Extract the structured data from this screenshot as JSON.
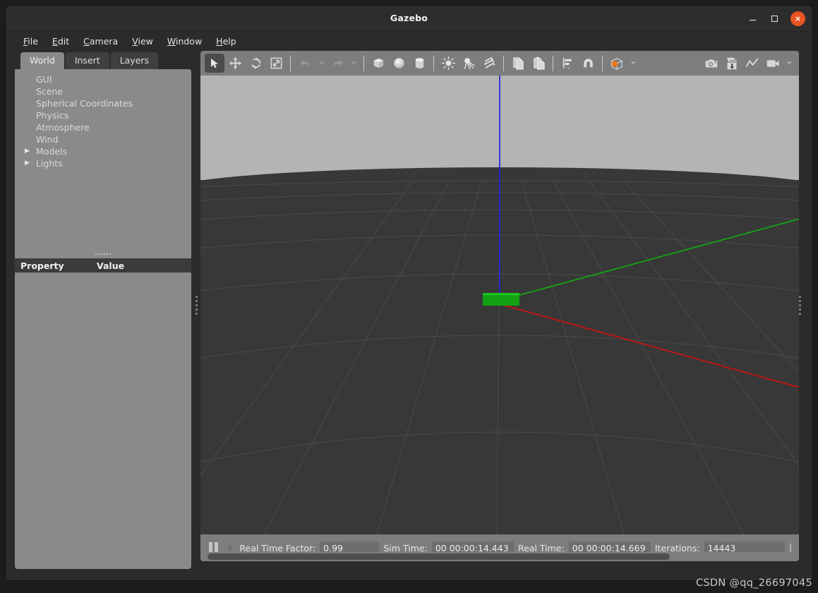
{
  "window": {
    "title": "Gazebo",
    "minimize_label": "minimize",
    "maximize_label": "maximize",
    "close_label": "×"
  },
  "menubar": {
    "items": [
      {
        "label": "File",
        "mnemonic": "F"
      },
      {
        "label": "Edit",
        "mnemonic": "E"
      },
      {
        "label": "Camera",
        "mnemonic": "C"
      },
      {
        "label": "View",
        "mnemonic": "V"
      },
      {
        "label": "Window",
        "mnemonic": "W"
      },
      {
        "label": "Help",
        "mnemonic": "H"
      }
    ]
  },
  "left_panel": {
    "tabs": [
      {
        "label": "World",
        "active": true
      },
      {
        "label": "Insert",
        "active": false
      },
      {
        "label": "Layers",
        "active": false
      }
    ],
    "tree": [
      {
        "label": "GUI",
        "expandable": false
      },
      {
        "label": "Scene",
        "expandable": false
      },
      {
        "label": "Spherical Coordinates",
        "expandable": false
      },
      {
        "label": "Physics",
        "expandable": false
      },
      {
        "label": "Atmosphere",
        "expandable": false
      },
      {
        "label": "Wind",
        "expandable": false
      },
      {
        "label": "Models",
        "expandable": true
      },
      {
        "label": "Lights",
        "expandable": true
      }
    ],
    "property_table": {
      "columns": [
        "Property",
        "Value"
      ],
      "rows": []
    }
  },
  "toolbar": {
    "groups": [
      {
        "buttons": [
          {
            "icon": "select-arrow-icon",
            "active": true
          },
          {
            "icon": "translate-icon",
            "active": false
          },
          {
            "icon": "rotate-icon",
            "active": false
          },
          {
            "icon": "scale-icon",
            "active": false
          }
        ]
      },
      {
        "buttons": [
          {
            "icon": "undo-icon",
            "active": false
          },
          {
            "icon": "undo-dropdown-icon",
            "active": false
          },
          {
            "icon": "redo-icon",
            "active": false
          },
          {
            "icon": "redo-dropdown-icon",
            "active": false
          }
        ]
      },
      {
        "buttons": [
          {
            "icon": "box-shape-icon",
            "active": false
          },
          {
            "icon": "sphere-shape-icon",
            "active": false
          },
          {
            "icon": "cylinder-shape-icon",
            "active": false
          }
        ]
      },
      {
        "buttons": [
          {
            "icon": "point-light-icon",
            "active": false
          },
          {
            "icon": "spot-light-icon",
            "active": false
          },
          {
            "icon": "directional-light-icon",
            "active": false
          }
        ]
      },
      {
        "buttons": [
          {
            "icon": "copy-icon",
            "active": false
          },
          {
            "icon": "paste-icon",
            "active": false
          }
        ]
      },
      {
        "buttons": [
          {
            "icon": "align-icon",
            "active": false
          },
          {
            "icon": "snap-magnet-icon",
            "active": false
          }
        ]
      },
      {
        "buttons": [
          {
            "icon": "view-transparency-cube-icon",
            "active": false
          }
        ]
      },
      {
        "buttons": [
          {
            "icon": "screenshot-camera-icon",
            "active": false
          },
          {
            "icon": "log-record-icon",
            "active": false
          },
          {
            "icon": "plot-icon",
            "active": false
          },
          {
            "icon": "video-record-icon",
            "active": false
          }
        ]
      }
    ],
    "accent_orange": "#f07818"
  },
  "viewport": {
    "sky_color": "#b4b4b4",
    "ground_color": "#383838",
    "grid_color": "#4f4f4f",
    "axes": [
      {
        "name": "x-axis",
        "color": "#cc1111"
      },
      {
        "name": "y-axis",
        "color": "#11aa11"
      },
      {
        "name": "z-axis",
        "color": "#2222dd"
      }
    ],
    "objects": [
      {
        "name": "green-box-model",
        "color": "#13a113"
      }
    ]
  },
  "statusbar": {
    "pause_label": "pause",
    "step_label": "step",
    "fields": [
      {
        "label": "Real Time Factor:",
        "value": "0.99"
      },
      {
        "label": "Sim Time:",
        "value": "00 00:00:14.443"
      },
      {
        "label": "Real Time:",
        "value": "00 00:00:14.669"
      },
      {
        "label": "Iterations:",
        "value": "14443"
      }
    ],
    "trailing": "|"
  },
  "watermark": {
    "text": "CSDN @qq_26697045"
  }
}
